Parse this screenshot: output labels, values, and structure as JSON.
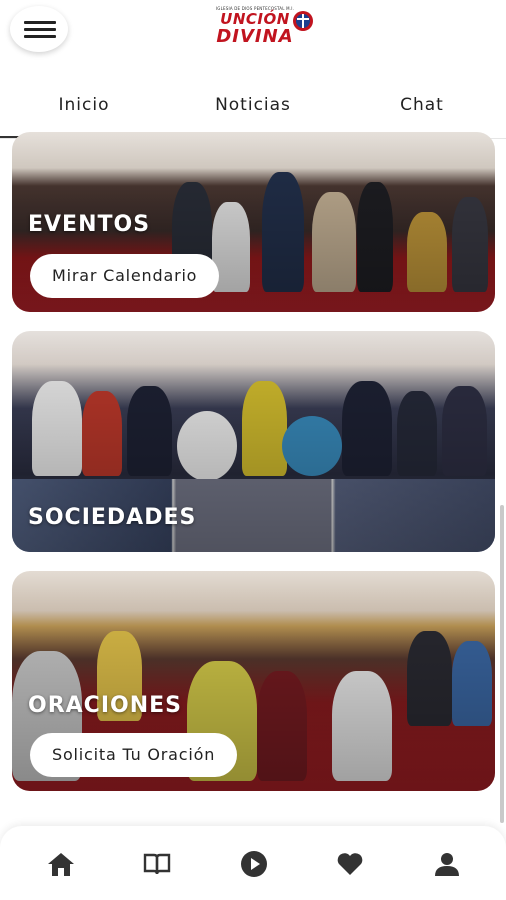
{
  "header": {
    "logo_small_text": "IGLESIA DE DIOS PENTECOSTAL M.I.",
    "logo_line1": "UNCIÓN",
    "logo_line2": "DIVINA"
  },
  "tabs": [
    {
      "label": "Inicio",
      "active": true
    },
    {
      "label": "Noticias",
      "active": false
    },
    {
      "label": "Chat",
      "active": false
    }
  ],
  "cards": [
    {
      "title": "EVENTOS",
      "button": "Mirar Calendario"
    },
    {
      "title": "SOCIEDADES"
    },
    {
      "title": "ORACIONES",
      "button": "Solicita Tu Oración"
    }
  ],
  "bottom_nav": [
    {
      "icon": "home-icon"
    },
    {
      "icon": "book-icon"
    },
    {
      "icon": "play-icon"
    },
    {
      "icon": "heart-icon"
    },
    {
      "icon": "profile-icon"
    }
  ],
  "colors": {
    "brand_red": "#c1141f",
    "nav_icon": "#333333",
    "card_floor_red": "#9a1a1c"
  }
}
